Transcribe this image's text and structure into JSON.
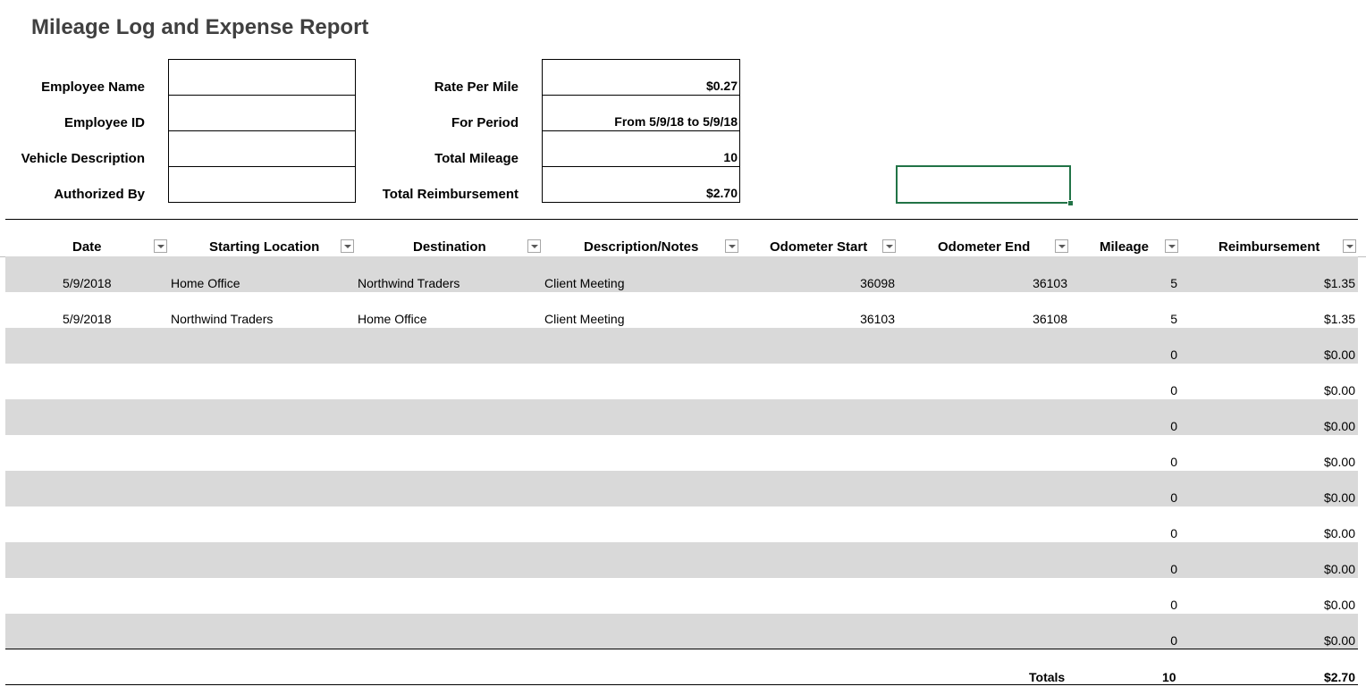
{
  "title": "Mileage Log and Expense Report",
  "info_left": [
    {
      "label": "Employee Name",
      "value": ""
    },
    {
      "label": "Employee ID",
      "value": ""
    },
    {
      "label": "Vehicle Description",
      "value": ""
    },
    {
      "label": "Authorized By",
      "value": ""
    }
  ],
  "info_right": [
    {
      "label": "Rate Per Mile",
      "value": "$0.27"
    },
    {
      "label": "For Period",
      "value": "From 5/9/18 to 5/9/18"
    },
    {
      "label": "Total Mileage",
      "value": "10"
    },
    {
      "label": "Total Reimbursement",
      "value": "$2.70"
    }
  ],
  "table": {
    "headers": [
      "Date",
      "Starting Location",
      "Destination",
      "Description/Notes",
      "Odometer Start",
      "Odometer End",
      "Mileage",
      "Reimbursement"
    ],
    "rows": [
      [
        "5/9/2018",
        "Home Office",
        "Northwind Traders",
        "Client Meeting",
        "36098",
        "36103",
        "5",
        "$1.35"
      ],
      [
        "5/9/2018",
        "Northwind Traders",
        "Home Office",
        "Client Meeting",
        "36103",
        "36108",
        "5",
        "$1.35"
      ],
      [
        "",
        "",
        "",
        "",
        "",
        "",
        "0",
        "$0.00"
      ],
      [
        "",
        "",
        "",
        "",
        "",
        "",
        "0",
        "$0.00"
      ],
      [
        "",
        "",
        "",
        "",
        "",
        "",
        "0",
        "$0.00"
      ],
      [
        "",
        "",
        "",
        "",
        "",
        "",
        "0",
        "$0.00"
      ],
      [
        "",
        "",
        "",
        "",
        "",
        "",
        "0",
        "$0.00"
      ],
      [
        "",
        "",
        "",
        "",
        "",
        "",
        "0",
        "$0.00"
      ],
      [
        "",
        "",
        "",
        "",
        "",
        "",
        "0",
        "$0.00"
      ],
      [
        "",
        "",
        "",
        "",
        "",
        "",
        "0",
        "$0.00"
      ],
      [
        "",
        "",
        "",
        "",
        "",
        "",
        "0",
        "$0.00"
      ]
    ],
    "totals": {
      "label": "Totals",
      "mileage": "10",
      "reimbursement": "$2.70"
    }
  },
  "colors": {
    "selection": "#217346",
    "band": "#d9d9d9",
    "title": "#404040"
  }
}
